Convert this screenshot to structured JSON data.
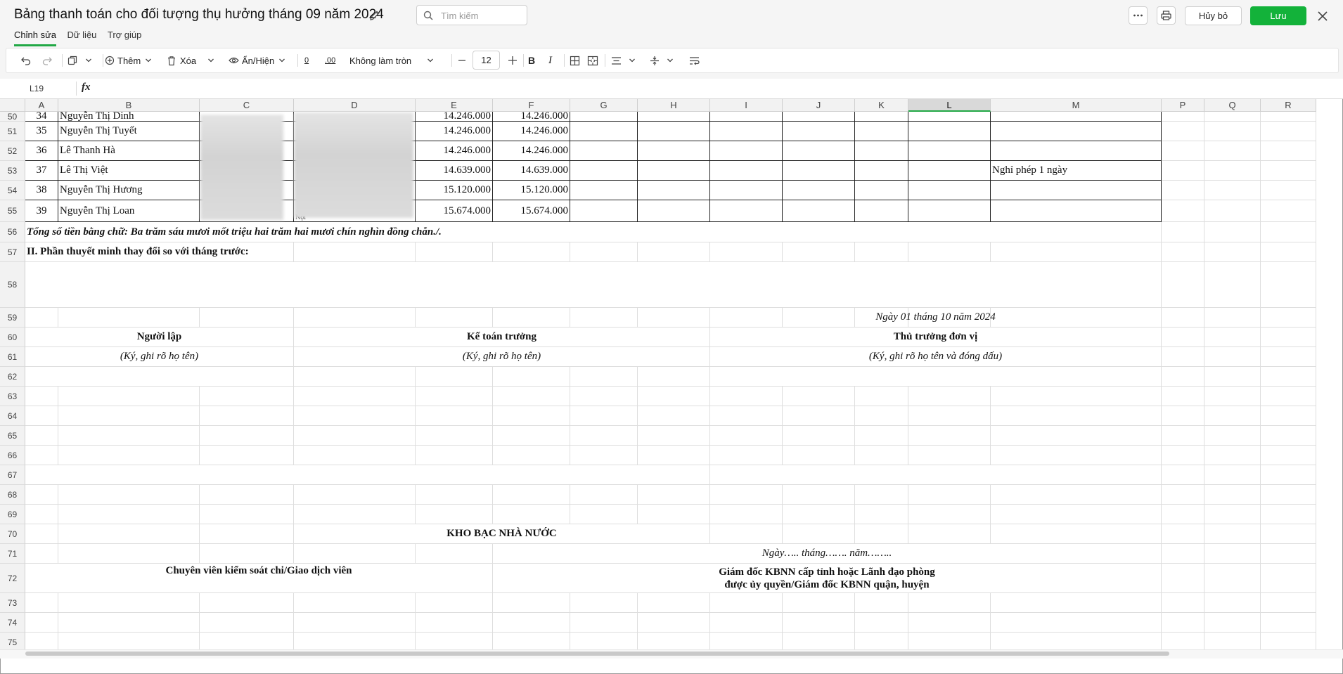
{
  "header": {
    "title": "Bảng thanh toán cho đối tượng thụ hưởng tháng 09 năm 2024",
    "search_placeholder": "Tìm kiếm",
    "cancel_label": "Hủy bỏ",
    "save_label": "Lưu",
    "tabs": [
      {
        "label": "Chỉnh sửa",
        "active": true
      },
      {
        "label": "Dữ liệu",
        "active": false
      },
      {
        "label": "Trợ giúp",
        "active": false
      }
    ]
  },
  "toolbar": {
    "add_label": "Thêm",
    "delete_label": "Xóa",
    "showhide_label": "Ẩn/Hiện",
    "rounding_label": "Không làm tròn",
    "decrease_decimal": "0",
    "increase_decimal": ".00",
    "font_size": "12",
    "bold": "B",
    "italic": "I"
  },
  "formula_bar": {
    "cell_ref": "L19",
    "fx_label": "fx"
  },
  "columns": [
    "A",
    "B",
    "C",
    "D",
    "E",
    "F",
    "G",
    "H",
    "I",
    "J",
    "K",
    "L",
    "M",
    "P",
    "Q",
    "R"
  ],
  "selected_column": "L",
  "row_numbers": [
    "50",
    "51",
    "52",
    "53",
    "54",
    "55",
    "56",
    "57",
    "58",
    "59",
    "60",
    "61",
    "62",
    "63",
    "64",
    "65",
    "66",
    "67",
    "68",
    "69",
    "70",
    "71",
    "72",
    "73",
    "74",
    "75"
  ],
  "rows": {
    "r50": {
      "a": "34",
      "b": "Nguyễn Thị Dinh",
      "e": "14.246.000",
      "f": "14.246.000"
    },
    "r51": {
      "a": "35",
      "b": "Nguyễn Thị Tuyết",
      "e": "14.246.000",
      "f": "14.246.000"
    },
    "r52": {
      "a": "36",
      "b": "Lê Thanh Hà",
      "e": "14.246.000",
      "f": "14.246.000"
    },
    "r53": {
      "a": "37",
      "b": "Lê Thị Việt",
      "e": "14.639.000",
      "f": "14.639.000",
      "m": "Nghỉ phép 1 ngày"
    },
    "r54": {
      "a": "38",
      "b": "Nguyễn Thị Hương",
      "e": "15.120.000",
      "f": "15.120.000"
    },
    "r55": {
      "a": "39",
      "b": "Nguyễn Thị Loan",
      "e": "15.674.000",
      "f": "15.674.000"
    }
  },
  "sheet_text": {
    "total_words": "Tổng số tiền bằng chữ: Ba trăm sáu mươi mốt triệu hai trăm hai mươi chín nghìn đồng chẵn./.",
    "section_two": "II. Phần thuyết minh thay đổi so với tháng trước:",
    "date_line": "Ngày 01 tháng 10 năm 2024",
    "preparer": "Người lập",
    "chief_accountant": "Kế toán trưởng",
    "head_of_unit": "Thủ trưởng đơn vị",
    "sign_note": "(Ký, ghi rõ họ tên)",
    "sign_note_seal": "(Ký, ghi rõ họ tên và đóng dấu)",
    "treasury": "KHO BẠC NHÀ NƯỚC",
    "blank_date": "Ngày….. tháng……. năm……..",
    "controller": "Chuyên viên kiểm soát chi/Giao dịch viên",
    "director_line1": "Giám đốc KBNN cấp tỉnh hoặc Lãnh đạo phòng",
    "director_line2": "được ủy quyền/Giám đốc KBNN quận, huyện",
    "d55_fragment": "Nội"
  }
}
